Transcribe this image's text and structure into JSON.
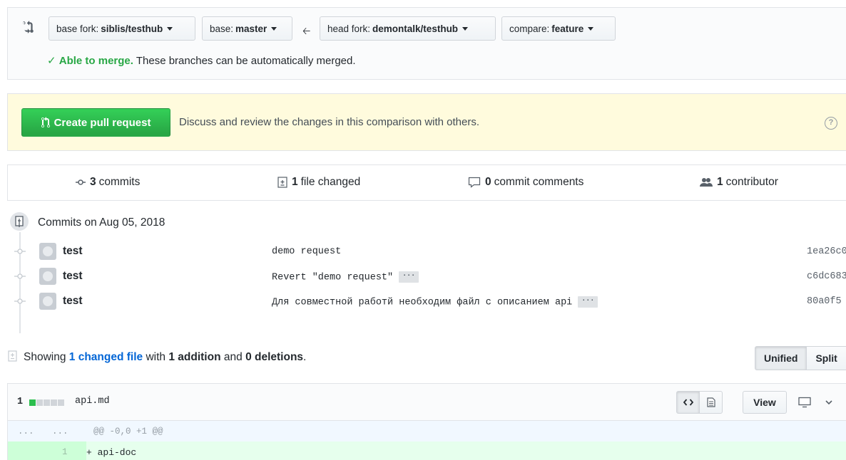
{
  "range": {
    "base_fork_label": "base fork:",
    "base_fork_value": "siblis/testhub",
    "base_label": "base:",
    "base_value": "master",
    "head_fork_label": "head fork:",
    "head_fork_value": "demontalk/testhub",
    "compare_label": "compare:",
    "compare_value": "feature",
    "merge_ok": "Able to merge.",
    "merge_msg": "These branches can be automatically merged."
  },
  "pr_banner": {
    "button_label": "Create pull request",
    "description": "Discuss and review the changes in this comparison with others."
  },
  "summary": {
    "commits_count": "3",
    "commits_label": "commits",
    "files_count": "1",
    "files_label": "file changed",
    "comments_count": "0",
    "comments_label": "commit comments",
    "contributors_count": "1",
    "contributors_label": "contributor"
  },
  "commits": {
    "date_heading": "Commits on Aug 05, 2018",
    "items": [
      {
        "author": "test",
        "message": "demo request",
        "sha": "1ea26c0"
      },
      {
        "author": "test",
        "message": "Revert \"demo request\"",
        "sha": "c6dc683"
      },
      {
        "author": "test",
        "message": "Для совместной работй необходим файл с описанием api",
        "sha": "80a0f5"
      }
    ]
  },
  "toc": {
    "showing": "Showing",
    "changed_link": "1 changed file",
    "with": "with",
    "additions": "1 addition",
    "and": "and",
    "deletions": "0 deletions",
    "unified": "Unified",
    "split": "Split"
  },
  "file": {
    "diffstat_num": "1",
    "diffstat_fill": 0.2,
    "name": "api.md",
    "view_label": "View",
    "hunk_ln_left": "...",
    "hunk_ln_right": "...",
    "hunk_header": "@@ -0,0 +1 @@",
    "add_line_num": "1",
    "add_line_text": "+ api-doc"
  },
  "colors": {
    "green": "#28a745",
    "link": "#0366d6",
    "banner_bg": "#fffbdd",
    "add_bg": "#e6ffed",
    "hunk_bg": "#f1f8ff"
  }
}
